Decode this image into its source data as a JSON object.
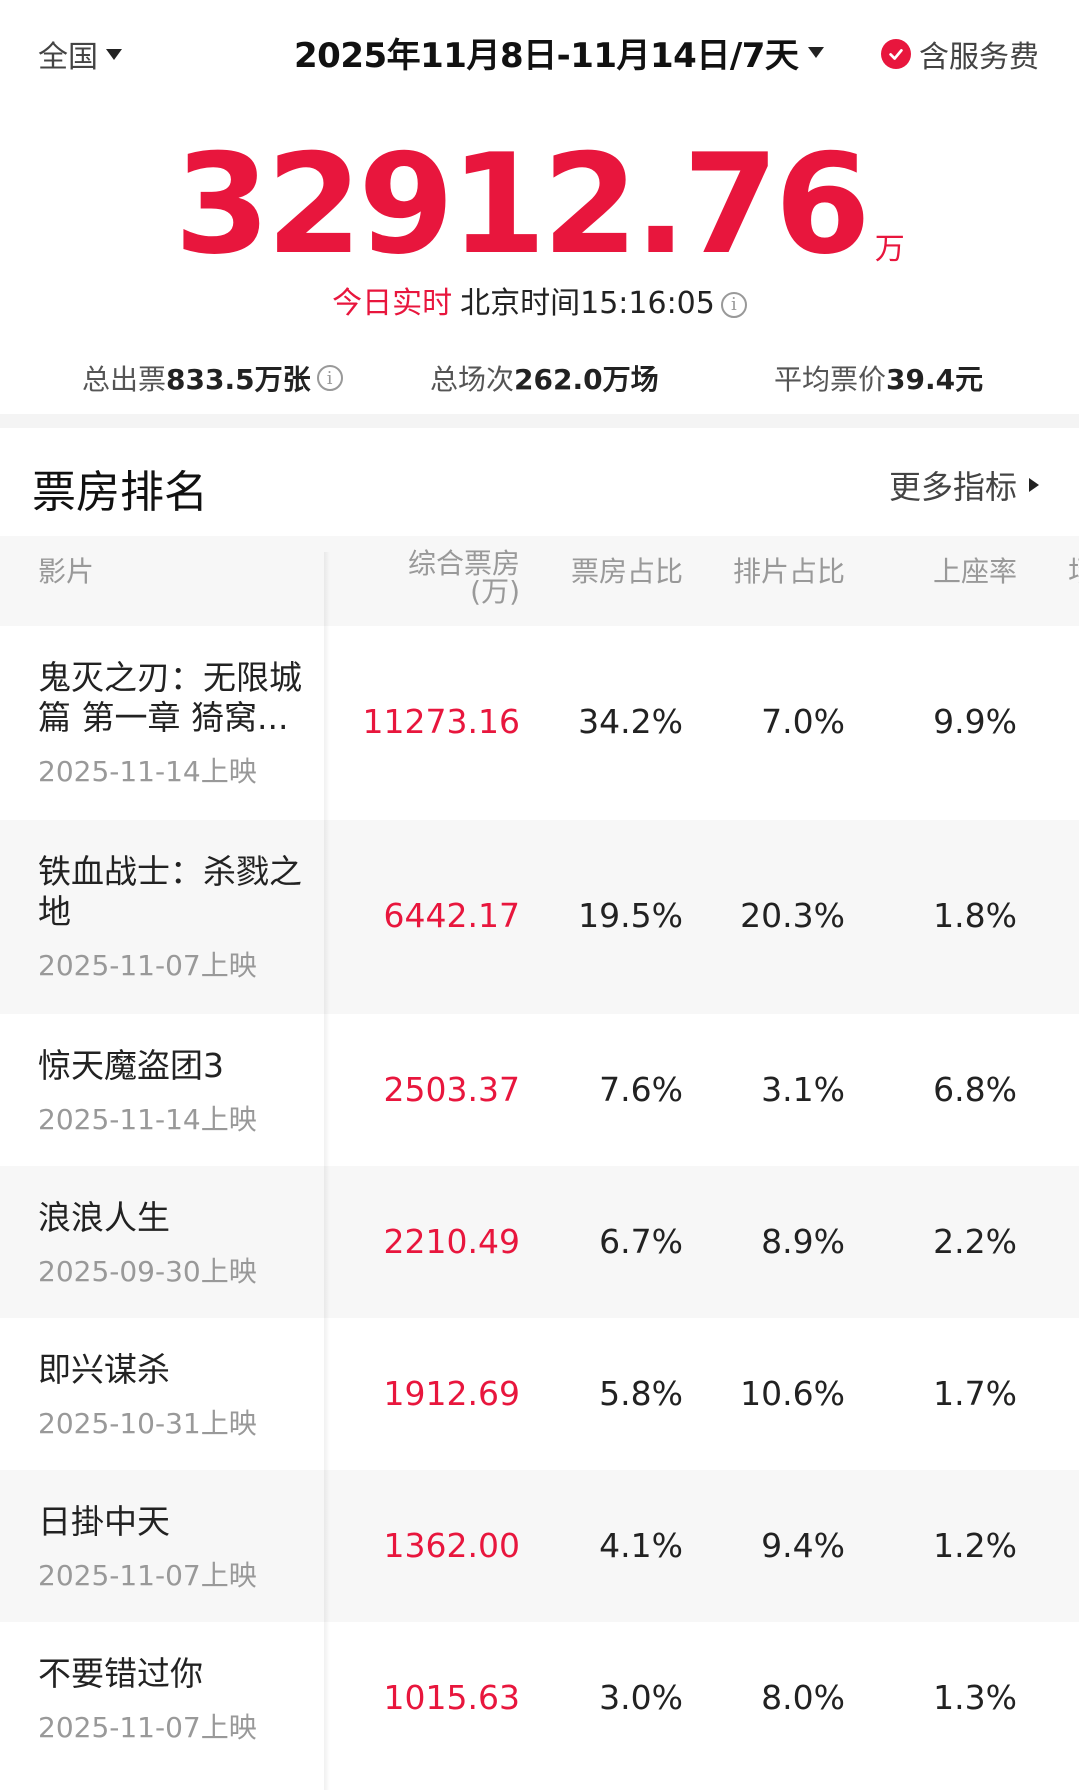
{
  "header": {
    "region": "全国",
    "date_range": "2025年11月8日-11月14日/7天",
    "service_fee": "含服务费"
  },
  "summary": {
    "total_box_office": "32912.76",
    "unit": "万",
    "realtime_label": "今日实时",
    "realtime_time": "北京时间15:16:05"
  },
  "stats": {
    "tickets_label": "总出票",
    "tickets_value": "833.5万张",
    "shows_label": "总场次",
    "shows_value": "262.0万场",
    "avg_price_label": "平均票价",
    "avg_price_value": "39.4元"
  },
  "ranking": {
    "title": "票房排名",
    "more_label": "更多指标",
    "columns": {
      "film": "影片",
      "box_office": "综合票房",
      "box_office_unit": "(万)",
      "bo_share": "票房占比",
      "show_share": "排片占比",
      "occupancy": "上座率",
      "cutoff": "场"
    },
    "rows": [
      {
        "name": "鬼灭之刃：无限城篇 第一章 猗窝...",
        "date": "2025-11-14上映",
        "box_office": "11273.16",
        "bo_share": "34.2%",
        "show_share": "7.0%",
        "occupancy": "9.9%"
      },
      {
        "name": "铁血战士：杀戮之地",
        "date": "2025-11-07上映",
        "box_office": "6442.17",
        "bo_share": "19.5%",
        "show_share": "20.3%",
        "occupancy": "1.8%"
      },
      {
        "name": "惊天魔盗团3",
        "date": "2025-11-14上映",
        "box_office": "2503.37",
        "bo_share": "7.6%",
        "show_share": "3.1%",
        "occupancy": "6.8%"
      },
      {
        "name": "浪浪人生",
        "date": "2025-09-30上映",
        "box_office": "2210.49",
        "bo_share": "6.7%",
        "show_share": "8.9%",
        "occupancy": "2.2%"
      },
      {
        "name": "即兴谋杀",
        "date": "2025-10-31上映",
        "box_office": "1912.69",
        "bo_share": "5.8%",
        "show_share": "10.6%",
        "occupancy": "1.7%"
      },
      {
        "name": "日掛中天",
        "date": "2025-11-07上映",
        "box_office": "1362.00",
        "bo_share": "4.1%",
        "show_share": "9.4%",
        "occupancy": "1.2%"
      },
      {
        "name": "不要错过你",
        "date": "2025-11-07上映",
        "box_office": "1015.63",
        "bo_share": "3.0%",
        "show_share": "8.0%",
        "occupancy": "1.3%"
      }
    ]
  },
  "colors": {
    "accent": "#e8163d",
    "alt_row": "#f7f7f7"
  },
  "icons": [
    "caret-down-icon",
    "check-circle-icon",
    "info-icon",
    "triangle-right-icon"
  ]
}
